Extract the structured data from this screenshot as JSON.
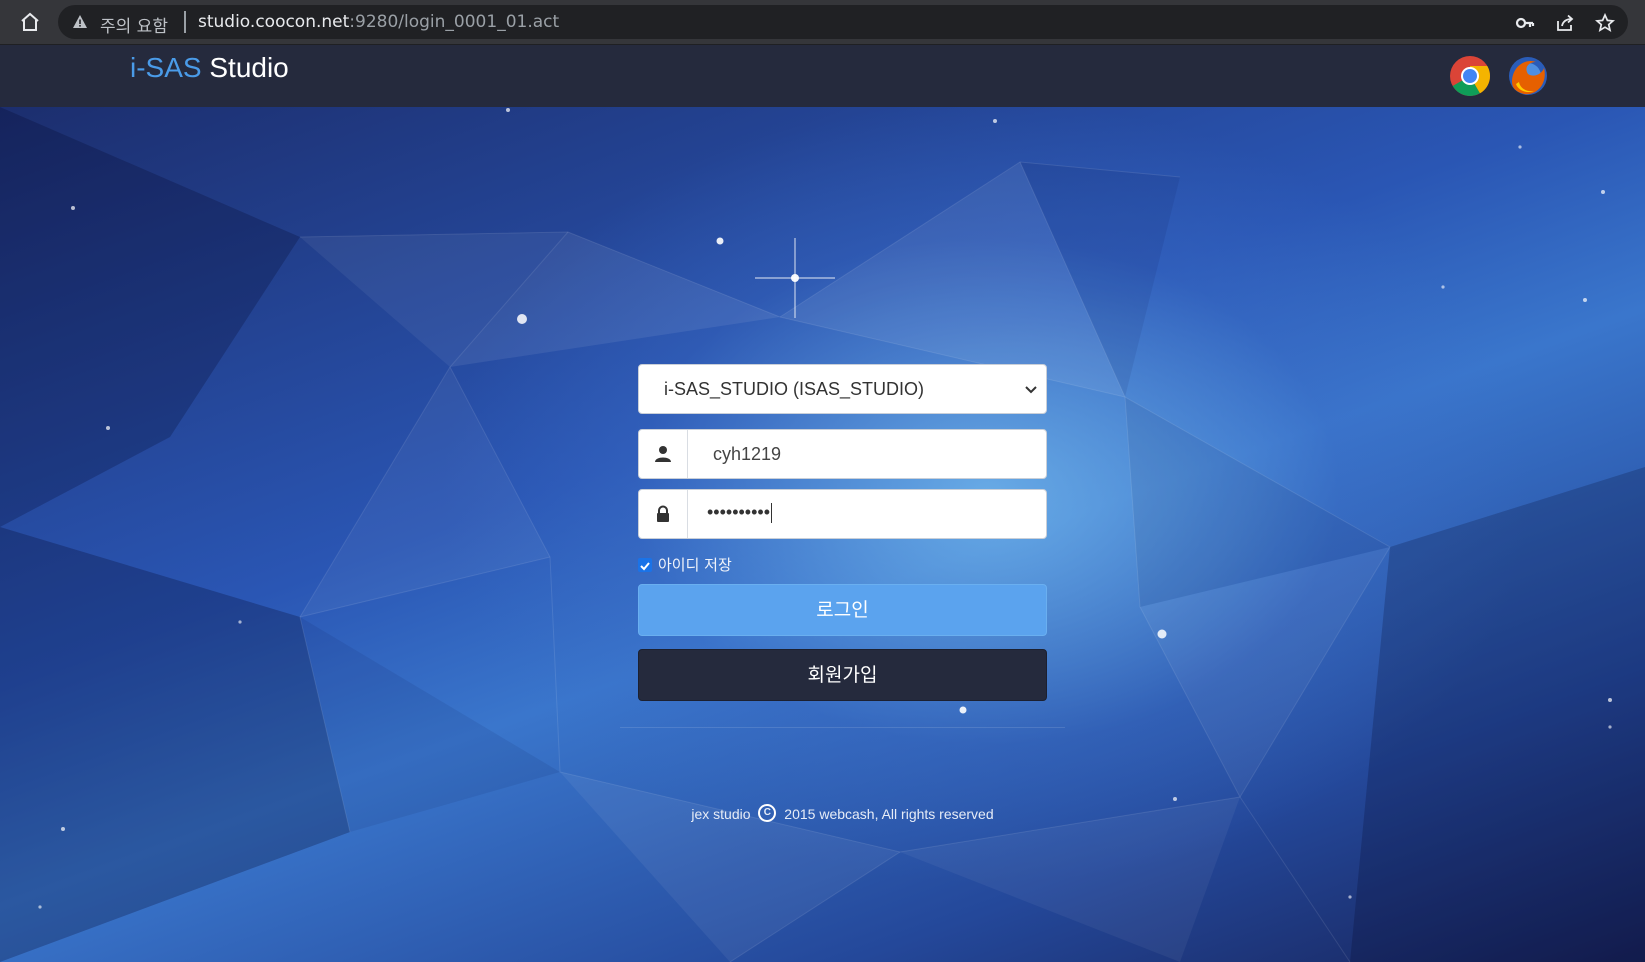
{
  "browser": {
    "security_warning": "주의 요함",
    "url_host": "studio.coocon.net",
    "url_path": ":9280/login_0001_01.act",
    "icons": [
      "home-icon",
      "warning-icon",
      "key-icon",
      "share-icon",
      "star-icon"
    ]
  },
  "header": {
    "brand_accent": "i-SAS",
    "brand_main": "Studio",
    "supported_browsers": [
      "chrome-logo",
      "firefox-logo"
    ]
  },
  "login": {
    "system_select": "i-SAS_STUDIO (ISAS_STUDIO)",
    "username": "cyh1219",
    "password_masked": "••••••••••",
    "remember_label": "아이디 저장",
    "remember_checked": true,
    "login_label": "로그인",
    "join_label": "회원가입"
  },
  "footer": {
    "prefix": "jex studio",
    "copy_symbol": "C",
    "text": "2015 webcash, All rights reserved"
  },
  "colors": {
    "accent": "#4a9be8",
    "login_button": "#5ba3ee",
    "join_button": "#252a3d",
    "header_bg": "#252a3d"
  }
}
